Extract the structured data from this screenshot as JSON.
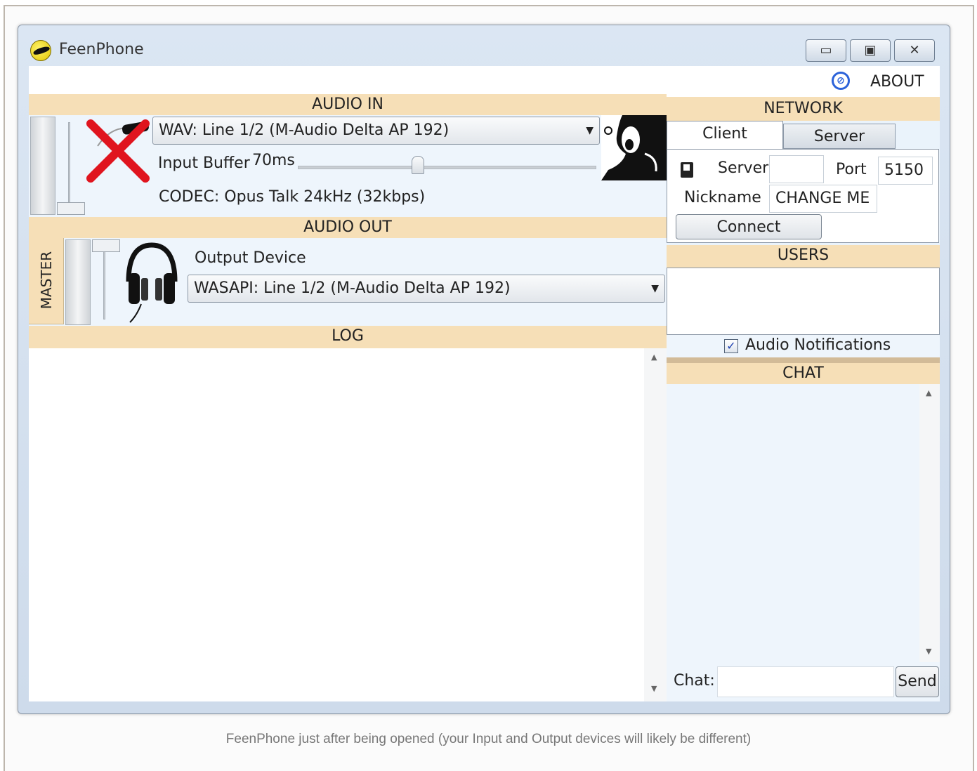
{
  "window": {
    "title": "FeenPhone",
    "controls": {
      "minimize": "▭",
      "maximize": "▣",
      "close": "✕"
    }
  },
  "menu": {
    "about_label": "ABOUT"
  },
  "audio_in": {
    "header": "AUDIO IN",
    "device": "WAV: Line 1/2 (M-Audio Delta AP 192)",
    "input_buffer_label": "Input Buffer",
    "input_buffer_value": "70ms",
    "input_buffer_level": 0.4,
    "codec": "CODEC: Opus Talk 24kHz (32kbps)"
  },
  "audio_out": {
    "header": "AUDIO OUT",
    "master_label": "MASTER",
    "output_device_label": "Output Device",
    "device": "WASAPI: Line 1/2 (M-Audio Delta AP 192)"
  },
  "log": {
    "header": "LOG"
  },
  "network": {
    "header": "NETWORK",
    "tabs": [
      {
        "label": "Client",
        "active": true
      },
      {
        "label": "Server",
        "active": false
      }
    ],
    "server_label": "Server",
    "server_value": "",
    "port_label": "Port",
    "port_value": "5150",
    "nickname_label": "Nickname",
    "nickname_value": "CHANGE ME",
    "connect_label": "Connect"
  },
  "users": {
    "header": "USERS",
    "audio_notifications_label": "Audio Notifications",
    "audio_notifications_checked": true
  },
  "chat": {
    "header": "CHAT",
    "chat_label": "Chat:",
    "send_label": "Send",
    "input_value": ""
  },
  "caption": "FeenPhone just after being opened (your Input and Output devices will likely be different)",
  "colors": {
    "header_bg": "#f6dfb7",
    "panel_bg": "#eef5fc",
    "window_frame": "#dbe6f3"
  },
  "icons": [
    "app-icon",
    "about-icon",
    "muted-mic-icon",
    "shouting-person-icon",
    "headphones-icon",
    "server-list-icon"
  ]
}
